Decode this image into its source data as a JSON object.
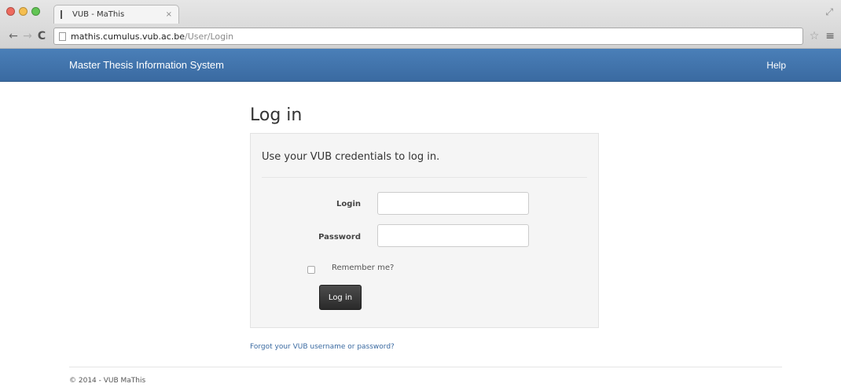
{
  "browser": {
    "tab_title": "VUB - MaThis",
    "tab_close": "×",
    "url_host": "mathis.cumulus.vub.ac.be",
    "url_path": "/User/Login",
    "icons": {
      "back": "back-arrow-icon",
      "forward": "forward-arrow-icon",
      "reload": "reload-icon",
      "star": "star-icon",
      "menu": "menu-icon"
    }
  },
  "navbar": {
    "brand": "Master Thesis Information System",
    "help": "Help",
    "color": "#3f72ab"
  },
  "page": {
    "title": "Log in",
    "panel_heading": "Use your VUB credentials to log in.",
    "fields": {
      "login_label": "Login",
      "login_value": "",
      "password_label": "Password",
      "password_value": ""
    },
    "remember_label": "Remember me?",
    "remember_checked": false,
    "submit_label": "Log in",
    "forgot_link": "Forgot your VUB username or password?",
    "footer": "© 2014 - VUB MaThis"
  }
}
